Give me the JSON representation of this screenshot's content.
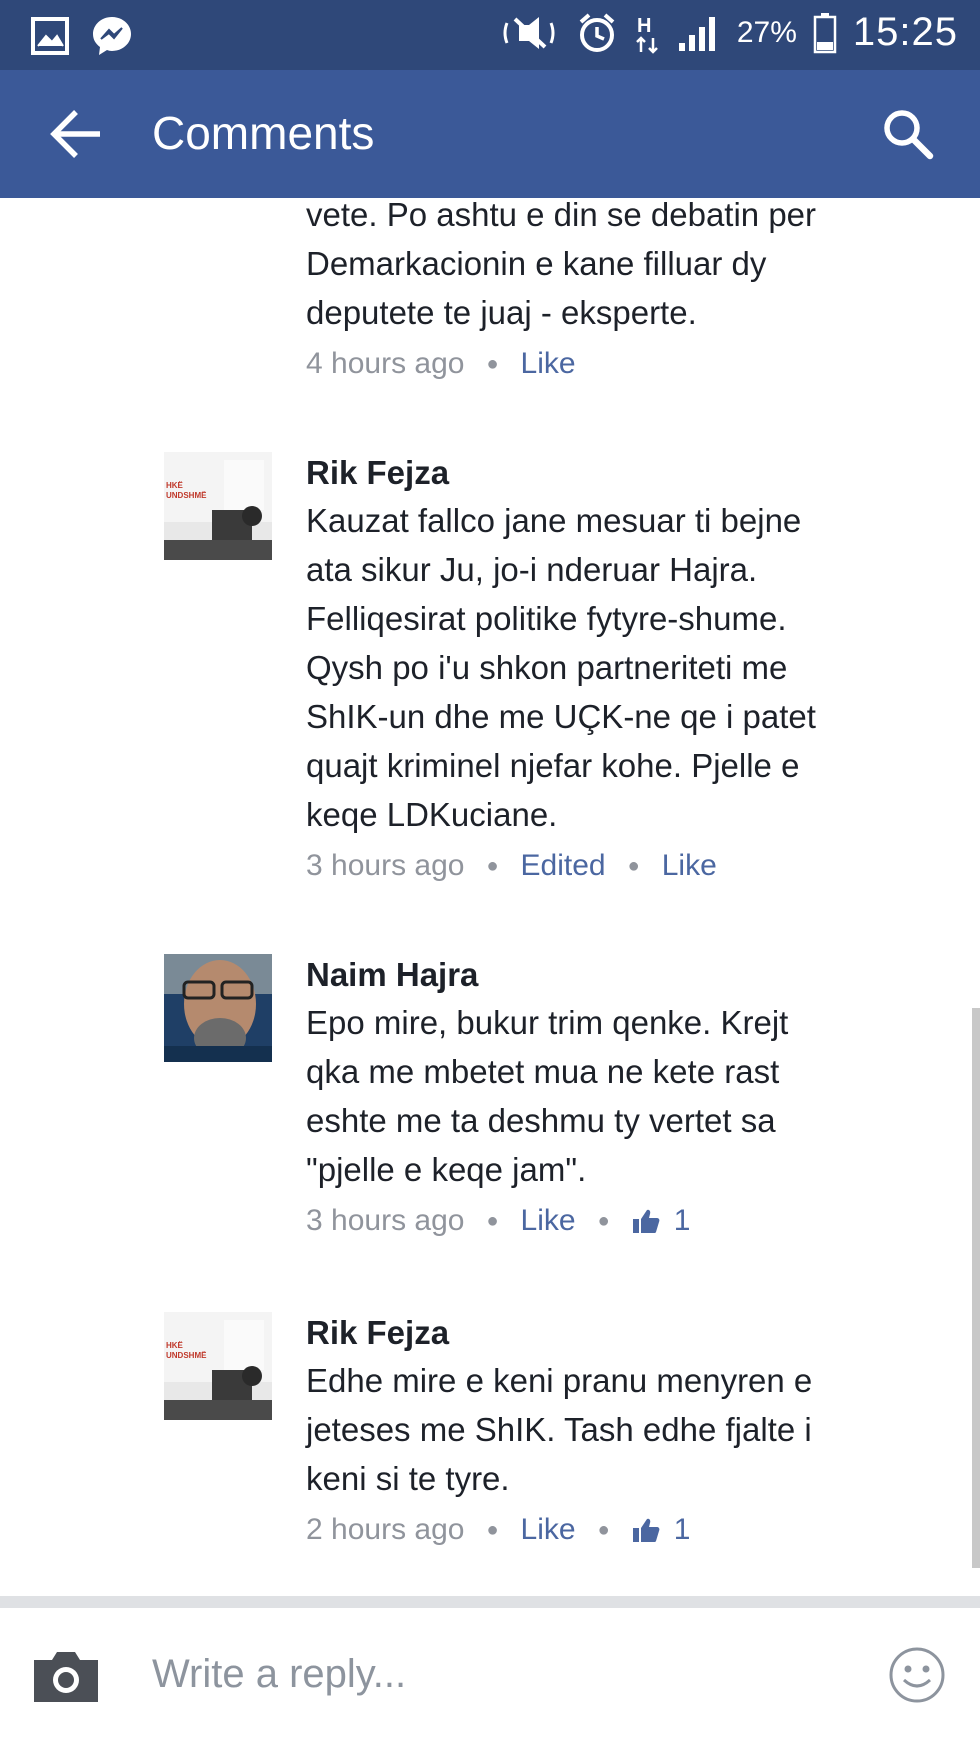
{
  "status_bar": {
    "battery_percent": "27%",
    "time": "15:25",
    "icons": [
      "gallery-icon",
      "messenger-icon",
      "mute-icon",
      "alarm-icon",
      "h-plus-icon",
      "signal-icon",
      "battery-icon"
    ]
  },
  "app_bar": {
    "title": "Comments",
    "icons": [
      "back-arrow-icon",
      "search-icon"
    ]
  },
  "comments": [
    {
      "author": "",
      "text_lines": [
        "vete. Po ashtu e din se debatin per",
        "Demarkacionin e kane filluar dy",
        "deputete te juaj - eksperte."
      ],
      "time": "4 hours ago",
      "edited": "",
      "like_label": "Like",
      "like_count": ""
    },
    {
      "author": "Rik Fejza",
      "avatar_text": [
        "HKË",
        "UNDSHMË"
      ],
      "text_lines": [
        "Kauzat fallco jane mesuar ti bejne",
        "ata sikur Ju, jo-i nderuar Hajra.",
        "Felliqesirat politike fytyre-shume.",
        "Qysh po i'u shkon partneriteti me",
        "ShIK-un dhe me UÇK-ne qe i patet",
        "quajt kriminel njefar kohe. Pjelle e",
        "keqe LDKuciane."
      ],
      "time": "3 hours ago",
      "edited": "Edited",
      "like_label": "Like",
      "like_count": ""
    },
    {
      "author": "Naim Hajra",
      "text_lines": [
        "Epo mire, bukur trim qenke. Krejt",
        "qka me mbetet mua ne kete rast",
        "eshte me ta deshmu ty vertet sa",
        "\"pjelle e keqe jam\"."
      ],
      "time": "3 hours ago",
      "edited": "",
      "like_label": "Like",
      "like_count": "1"
    },
    {
      "author": "Rik Fejza",
      "avatar_text": [
        "HKË",
        "UNDSHMË"
      ],
      "text_lines": [
        "Edhe mire e keni pranu menyren e",
        "jeteses me ShIK. Tash edhe fjalte i",
        "keni si te tyre."
      ],
      "time": "2 hours ago",
      "edited": "",
      "like_label": "Like",
      "like_count": "1"
    }
  ],
  "reply_bar": {
    "placeholder": "Write a reply...",
    "icons": [
      "camera-icon",
      "emoji-icon"
    ]
  },
  "colors": {
    "status_bar": "#2f4879",
    "app_bar": "#3b5998",
    "link": "#4b67a1",
    "meta": "#90949c"
  }
}
